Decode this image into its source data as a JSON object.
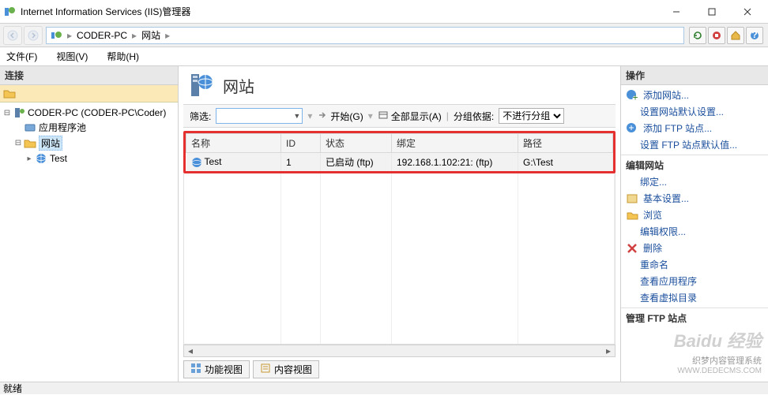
{
  "window": {
    "title": "Internet Information Services (IIS)管理器"
  },
  "breadcrumb": {
    "items": [
      "CODER-PC",
      "网站"
    ]
  },
  "menu": {
    "file": "文件(F)",
    "view": "视图(V)",
    "help": "帮助(H)"
  },
  "left_panel": {
    "header": "连接",
    "tree": {
      "root": "CODER-PC (CODER-PC\\Coder)",
      "app_pools": "应用程序池",
      "sites": "网站",
      "site_test": "Test"
    }
  },
  "center": {
    "title": "网站",
    "filter": {
      "label": "筛选:",
      "start": "开始(G)",
      "show_all": "全部显示(A)",
      "group_by_label": "分组依据:",
      "group_by_value": "不进行分组"
    },
    "columns": {
      "name": "名称",
      "id": "ID",
      "status": "状态",
      "binding": "绑定",
      "path": "路径"
    },
    "rows": [
      {
        "name": "Test",
        "id": "1",
        "status": "已启动 (ftp)",
        "binding": "192.168.1.102:21: (ftp)",
        "path": "G:\\Test"
      }
    ],
    "view_tabs": {
      "features": "功能视图",
      "content": "内容视图"
    }
  },
  "right_panel": {
    "header": "操作",
    "add_site": "添加网站...",
    "set_defaults": "设置网站默认设置...",
    "add_ftp": "添加 FTP 站点...",
    "set_ftp_defaults": "设置 FTP 站点默认值...",
    "edit_site_header": "编辑网站",
    "bindings": "绑定...",
    "basic_settings": "基本设置...",
    "browse": "浏览",
    "edit_permissions": "编辑权限...",
    "delete": "删除",
    "rename": "重命名",
    "view_apps": "查看应用程序",
    "view_vdirs": "查看虚拟目录",
    "manage_ftp_header": "管理 FTP 站点"
  },
  "statusbar": {
    "text": "就绪"
  },
  "watermark": {
    "line1": "Baidu 经验",
    "line2": "织梦内容管理系统",
    "line3": "WWW.DEDECMS.COM"
  }
}
